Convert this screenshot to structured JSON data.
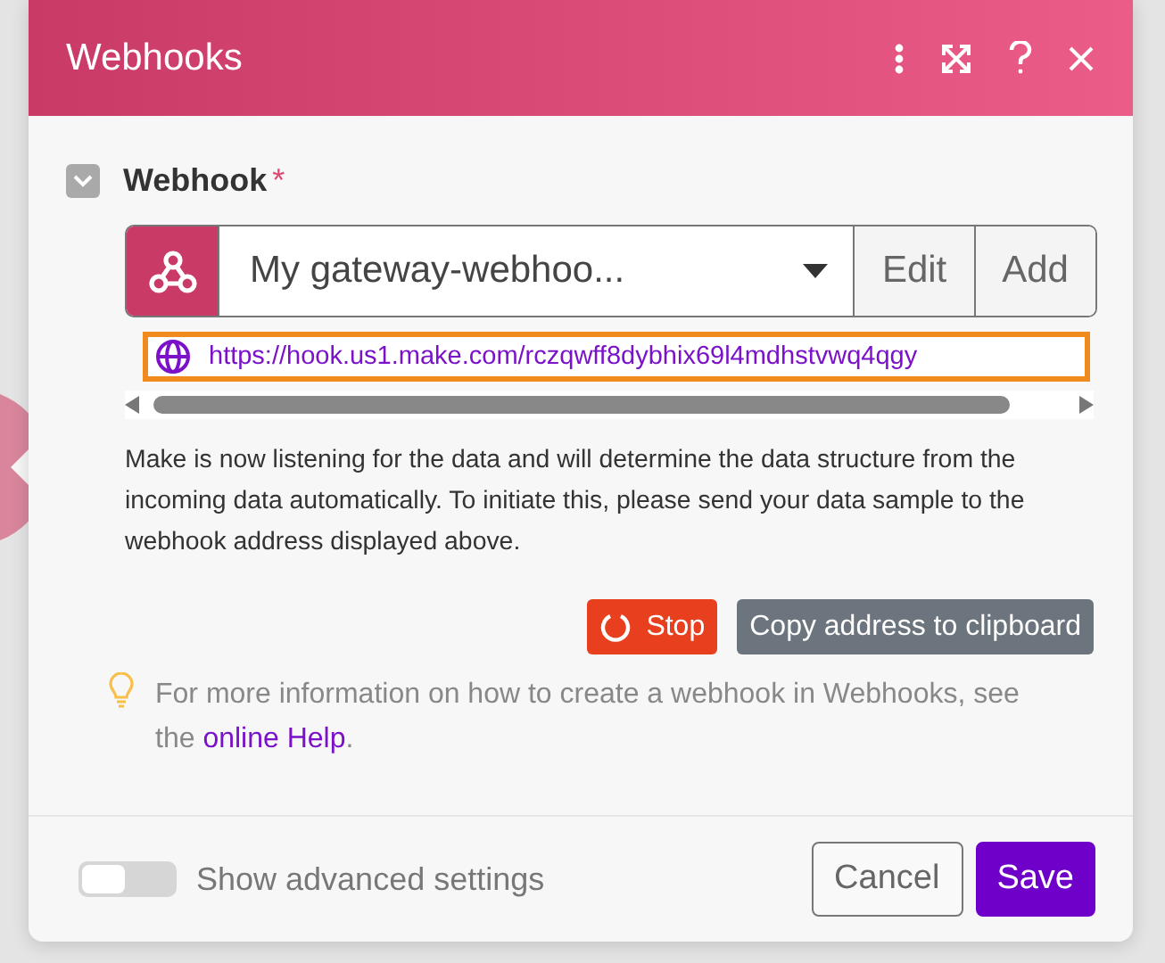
{
  "dialog": {
    "title": "Webhooks"
  },
  "field": {
    "label": "Webhook",
    "required_mark": "*",
    "expanded": true,
    "select": {
      "value": "My gateway-webhoo...",
      "buttons": [
        "Edit",
        "Add"
      ]
    },
    "url": "https://hook.us1.make.com/rczqwff8dybhix69l4mdhstvwq4qgy",
    "description": "Make is now listening for the data and will determine the data structure from the incoming data automatically. To initiate this, please send your data sample to the webhook address displayed above.",
    "actions": [
      {
        "kind": "stop",
        "label": "Stop"
      },
      {
        "kind": "copy",
        "label": "Copy address to clipboard"
      }
    ],
    "hint": {
      "before": "For more information on how to create a webhook in Webhooks, see the ",
      "link": "online Help",
      "after": "."
    }
  },
  "footer": {
    "toggle": {
      "label": "Show advanced settings",
      "on": false
    },
    "buttons": [
      {
        "kind": "secondary",
        "label": "Cancel"
      },
      {
        "kind": "primary",
        "label": "Save"
      }
    ]
  }
}
